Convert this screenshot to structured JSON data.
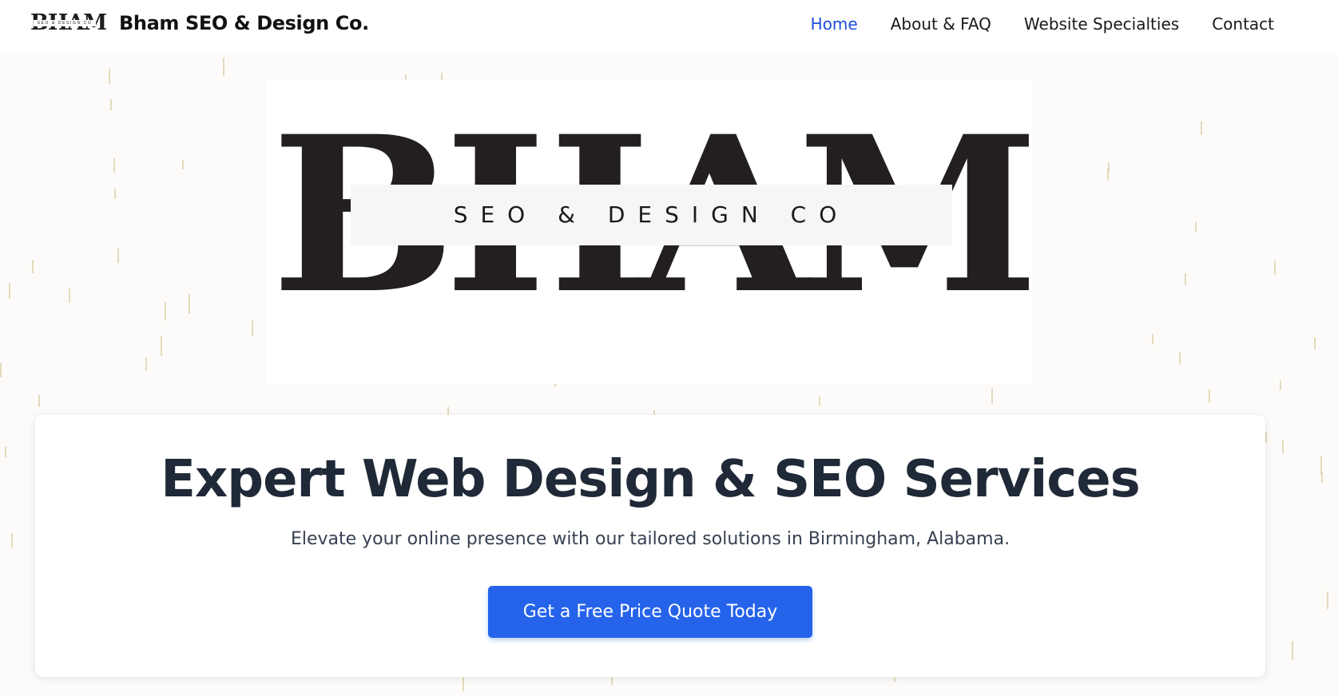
{
  "header": {
    "brand_logo_letters": "BHAM",
    "brand_logo_tagline": "SEO & DESIGN CO",
    "brand_name": "Bham SEO & Design Co.",
    "nav": [
      {
        "label": "Home",
        "active": true
      },
      {
        "label": "About & FAQ",
        "active": false
      },
      {
        "label": "Website Specialties",
        "active": false
      },
      {
        "label": "Contact",
        "active": false
      }
    ]
  },
  "hero_logo": {
    "letters": "BHAM",
    "tagline": "SEO & DESIGN CO"
  },
  "hero": {
    "title": "Expert Web Design & SEO Services",
    "subtitle": "Elevate your online presence with our tailored solutions in Birmingham, Alabama.",
    "cta_label": "Get a Free Price Quote Today"
  },
  "colors": {
    "accent": "#2563eb",
    "nav_active": "#1d4ed8",
    "heading": "#1f2937",
    "background": "#fdfbf9"
  }
}
